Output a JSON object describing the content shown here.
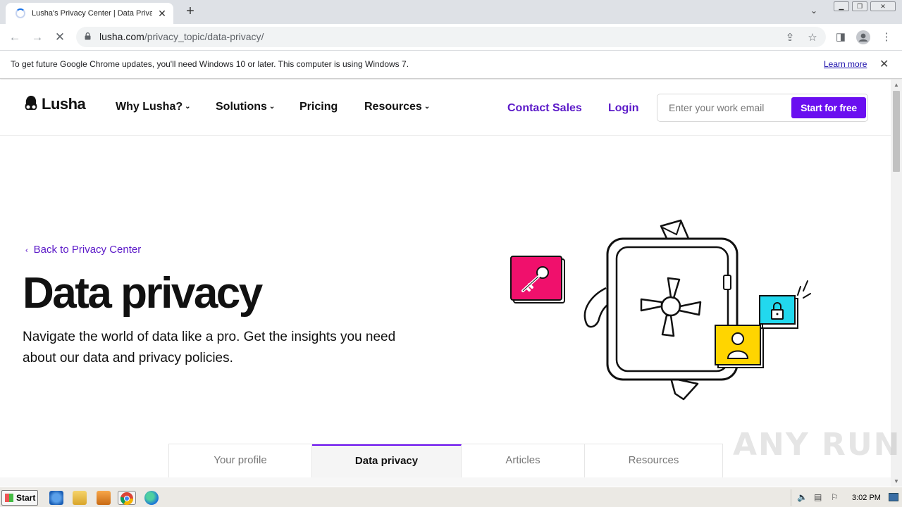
{
  "browser": {
    "tab_title": "Lusha's Privacy Center | Data Privac",
    "new_tab": "+",
    "url_host": "lusha.com",
    "url_path": "/privacy_topic/data-privacy/"
  },
  "infobar": {
    "message": "To get future Google Chrome updates, you'll need Windows 10 or later. This computer is using Windows 7.",
    "learn_more": "Learn more"
  },
  "site": {
    "logo_text": "Lusha",
    "nav": [
      {
        "label": "Why Lusha?"
      },
      {
        "label": "Solutions"
      },
      {
        "label": "Pricing"
      },
      {
        "label": "Resources"
      }
    ],
    "contact_sales": "Contact Sales",
    "login": "Login",
    "email_placeholder": "Enter your work email",
    "cta": "Start for free"
  },
  "hero": {
    "back_link": "Back to Privacy Center",
    "title": "Data privacy",
    "subtitle": "Navigate the world of data like a pro. Get the insights you need about our data and privacy policies."
  },
  "subnav": [
    {
      "label": "Your profile"
    },
    {
      "label": "Data privacy"
    },
    {
      "label": "Articles"
    },
    {
      "label": "Resources"
    }
  ],
  "watermark": "ANY RUN",
  "taskbar": {
    "start": "Start",
    "clock": "3:02 PM"
  },
  "colors": {
    "brand_purple": "#6a0ff0",
    "link_purple": "#5b19c8",
    "key_card": "#f0106c",
    "user_card": "#ffd500",
    "lock_card": "#22d8ee"
  }
}
